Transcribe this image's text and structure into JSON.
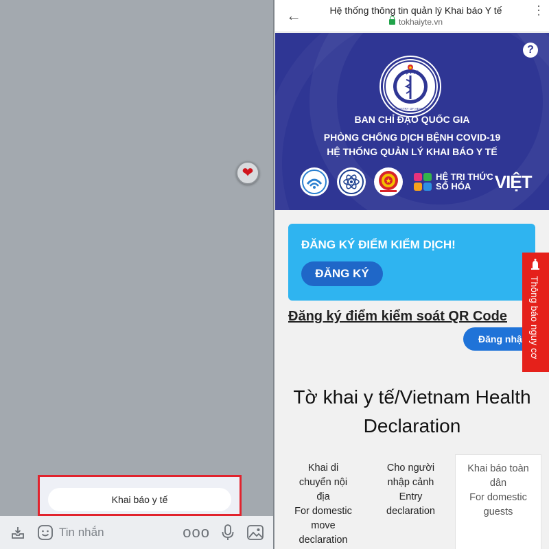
{
  "chat": {
    "quick_reply": "Khai báo y tế",
    "input_placeholder": "Tin nhắn",
    "more_label": "ooo"
  },
  "browser": {
    "title": "Hệ thống thông tin quản lý Khai báo Y tế",
    "url": "tokhaiyte.vn",
    "help_label": "?"
  },
  "banner": {
    "emblem_top": "BỘ Y TẾ",
    "emblem_bottom": "MINISTRY OF HEALTH",
    "line1": "BAN CHỈ ĐẠO QUỐC GIA",
    "line2": "PHÒNG CHỐNG DỊCH BỆNH COVID-19",
    "line3": "HỆ THỐNG QUẢN LÝ KHAI BÁO Y TẾ",
    "brand_top": "HỆ TRI THỨC",
    "brand_bottom": "SỐ HÓA",
    "brand_viet": "VIỆT"
  },
  "card": {
    "title": "ĐĂNG KÝ ĐIỂM KIỂM DỊCH!",
    "button": "ĐĂNG KÝ"
  },
  "qr_link": "Đăng ký điểm kiểm soát QR Code",
  "login_button": "Đăng nhập",
  "side_tab": "Thông báo nguy cơ",
  "heading_line1": "Tờ khai y tế/Vietnam Health",
  "heading_line2": "Declaration",
  "tabs": [
    {
      "lines": [
        "Khai di",
        "chuyển nội",
        "địa",
        "For domestic",
        "move",
        "declaration"
      ]
    },
    {
      "lines": [
        "Cho người",
        "nhập cảnh",
        "Entry",
        "declaration"
      ]
    },
    {
      "lines": [
        "Khai báo toàn",
        "dân",
        "For domestic",
        "guests"
      ]
    }
  ],
  "colors": {
    "banner": "#2f3694",
    "card": "#2fb4f0",
    "primary_button": "#1f67c8",
    "alert_tab": "#e5211b",
    "highlight_border": "#e1232d"
  }
}
